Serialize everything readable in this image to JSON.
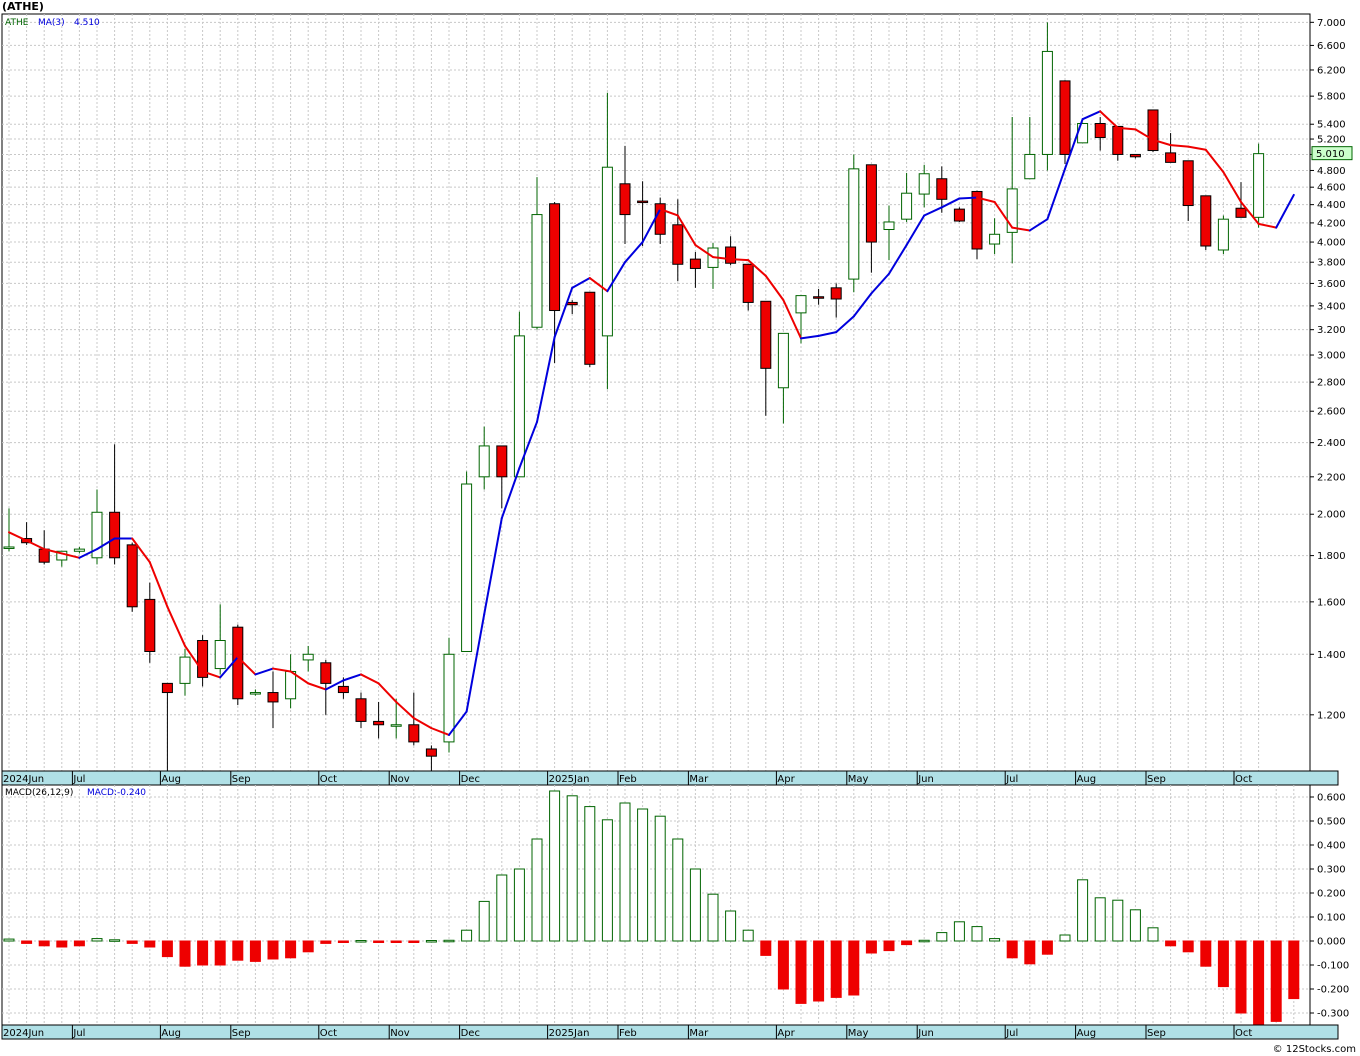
{
  "title": "(ATHE)",
  "watermark": "© 12Stocks.com",
  "colors": {
    "up": "#ffffff",
    "up_stroke": "#006400",
    "down": "#ee0000",
    "ma_up": "#0000dd",
    "ma_down": "#ee0000",
    "grid": "#c8c8c8",
    "axis_band": "#b0e0e6"
  },
  "chart_data": [
    {
      "type": "candlestick",
      "legend": {
        "ticker": "ATHE",
        "ma_label": "MA(3)",
        "ma_value": "4.510"
      },
      "last_price": "5.010",
      "y_scale": "log",
      "ylim": [
        1.04,
        7.15
      ],
      "y_ticks": [
        1.2,
        1.4,
        1.6,
        1.8,
        2.0,
        2.2,
        2.4,
        2.6,
        2.8,
        3.0,
        3.2,
        3.4,
        3.6,
        3.8,
        4.0,
        4.2,
        4.4,
        4.6,
        4.8,
        5.0,
        5.2,
        5.4,
        5.8,
        6.2,
        6.6,
        7.0
      ],
      "y_tick_labels": [
        "1.200",
        "1.400",
        "1.600",
        "1.800",
        "2.000",
        "2.200",
        "2.400",
        "2.600",
        "2.800",
        "3.000",
        "3.200",
        "3.400",
        "3.600",
        "3.800",
        "4.000",
        "4.200",
        "4.400",
        "4.600",
        "4.800",
        "5.000",
        "5.200",
        "5.400",
        "5.800",
        "6.200",
        "6.600",
        "7.000"
      ],
      "x_labels": [
        {
          "i": 0,
          "t": "2024Jun"
        },
        {
          "i": 4,
          "t": "Jul"
        },
        {
          "i": 9,
          "t": "Aug"
        },
        {
          "i": 13,
          "t": "Sep"
        },
        {
          "i": 18,
          "t": "Oct"
        },
        {
          "i": 22,
          "t": "Nov"
        },
        {
          "i": 26,
          "t": "Dec"
        },
        {
          "i": 31,
          "t": "2025Jan"
        },
        {
          "i": 35,
          "t": "Feb"
        },
        {
          "i": 39,
          "t": "Mar"
        },
        {
          "i": 44,
          "t": "Apr"
        },
        {
          "i": 48,
          "t": "May"
        },
        {
          "i": 52,
          "t": "Jun"
        },
        {
          "i": 57,
          "t": "Jul"
        },
        {
          "i": 61,
          "t": "Aug"
        },
        {
          "i": 65,
          "t": "Sep"
        },
        {
          "i": 70,
          "t": "Oct"
        }
      ],
      "candles": [
        [
          1.84,
          2.03,
          1.82,
          1.84
        ],
        [
          1.88,
          1.96,
          1.85,
          1.86
        ],
        [
          1.83,
          1.92,
          1.76,
          1.77
        ],
        [
          1.78,
          1.82,
          1.75,
          1.82
        ],
        [
          1.82,
          1.84,
          1.81,
          1.83
        ],
        [
          1.79,
          2.13,
          1.76,
          2.01
        ],
        [
          2.01,
          2.39,
          1.76,
          1.79
        ],
        [
          1.85,
          1.86,
          1.56,
          1.58
        ],
        [
          1.61,
          1.68,
          1.37,
          1.41
        ],
        [
          1.3,
          1.3,
          1.04,
          1.27
        ],
        [
          1.3,
          1.42,
          1.26,
          1.39
        ],
        [
          1.45,
          1.47,
          1.29,
          1.32
        ],
        [
          1.35,
          1.59,
          1.33,
          1.45
        ],
        [
          1.5,
          1.51,
          1.23,
          1.25
        ],
        [
          1.27,
          1.28,
          1.26,
          1.27
        ],
        [
          1.27,
          1.34,
          1.16,
          1.24
        ],
        [
          1.25,
          1.4,
          1.22,
          1.34
        ],
        [
          1.38,
          1.43,
          1.34,
          1.4
        ],
        [
          1.37,
          1.38,
          1.2,
          1.3
        ],
        [
          1.29,
          1.32,
          1.25,
          1.27
        ],
        [
          1.25,
          1.27,
          1.16,
          1.18
        ],
        [
          1.18,
          1.24,
          1.13,
          1.17
        ],
        [
          1.17,
          1.25,
          1.13,
          1.17
        ],
        [
          1.17,
          1.27,
          1.11,
          1.12
        ],
        [
          1.1,
          1.11,
          1.04,
          1.08
        ],
        [
          1.12,
          1.46,
          1.09,
          1.4
        ],
        [
          1.41,
          2.23,
          1.41,
          2.16
        ],
        [
          2.2,
          2.5,
          2.13,
          2.38
        ],
        [
          2.38,
          2.38,
          2.03,
          2.2
        ],
        [
          2.2,
          3.35,
          2.2,
          3.15
        ],
        [
          3.22,
          4.72,
          3.2,
          4.29
        ],
        [
          4.41,
          4.43,
          2.94,
          3.36
        ],
        [
          3.43,
          3.45,
          3.33,
          3.41
        ],
        [
          3.52,
          3.52,
          2.91,
          2.93
        ],
        [
          3.15,
          5.85,
          2.75,
          4.84
        ],
        [
          4.64,
          5.11,
          3.98,
          4.29
        ],
        [
          4.44,
          4.67,
          3.96,
          4.43
        ],
        [
          4.41,
          4.48,
          3.98,
          4.08
        ],
        [
          4.18,
          4.46,
          3.62,
          3.78
        ],
        [
          3.83,
          3.9,
          3.56,
          3.74
        ],
        [
          3.75,
          3.99,
          3.55,
          3.94
        ],
        [
          3.95,
          4.06,
          3.77,
          3.79
        ],
        [
          3.78,
          3.78,
          3.36,
          3.43
        ],
        [
          3.44,
          3.44,
          2.57,
          2.9
        ],
        [
          2.76,
          3.16,
          2.52,
          3.17
        ],
        [
          3.34,
          3.49,
          3.09,
          3.49
        ],
        [
          3.48,
          3.55,
          3.41,
          3.47
        ],
        [
          3.56,
          3.6,
          3.3,
          3.46
        ],
        [
          3.64,
          5.0,
          3.52,
          4.82
        ],
        [
          4.87,
          4.87,
          3.7,
          4.0
        ],
        [
          4.13,
          4.39,
          3.82,
          4.21
        ],
        [
          4.24,
          4.77,
          4.21,
          4.53
        ],
        [
          4.52,
          4.87,
          4.37,
          4.76
        ],
        [
          4.7,
          4.85,
          4.31,
          4.46
        ],
        [
          4.35,
          4.37,
          4.21,
          4.22
        ],
        [
          4.55,
          4.56,
          3.83,
          3.93
        ],
        [
          3.98,
          4.25,
          3.88,
          4.08
        ],
        [
          4.1,
          5.5,
          3.79,
          4.58
        ],
        [
          4.7,
          5.5,
          4.7,
          5.0
        ],
        [
          5.0,
          7.0,
          4.8,
          6.5
        ],
        [
          6.03,
          6.04,
          4.88,
          5.0
        ],
        [
          5.15,
          5.42,
          5.15,
          5.41
        ],
        [
          5.41,
          5.5,
          5.05,
          5.22
        ],
        [
          5.37,
          5.37,
          4.92,
          5.0
        ],
        [
          5.0,
          5.0,
          4.95,
          4.97
        ],
        [
          5.6,
          5.6,
          5.03,
          5.05
        ],
        [
          5.02,
          5.28,
          4.9,
          4.9
        ],
        [
          4.92,
          4.92,
          4.22,
          4.39
        ],
        [
          4.5,
          4.5,
          3.92,
          3.96
        ],
        [
          3.92,
          4.28,
          3.88,
          4.24
        ],
        [
          4.36,
          4.66,
          4.26,
          4.26
        ],
        [
          4.26,
          5.14,
          4.15,
          5.01
        ]
      ],
      "ma3": [
        1.91,
        1.87,
        1.83,
        1.81,
        1.79,
        1.83,
        1.88,
        1.88,
        1.77,
        1.58,
        1.43,
        1.34,
        1.32,
        1.39,
        1.33,
        1.35,
        1.34,
        1.3,
        1.28,
        1.31,
        1.33,
        1.3,
        1.24,
        1.19,
        1.16,
        1.14,
        1.21,
        1.55,
        1.98,
        2.25,
        2.53,
        3.14,
        3.56,
        3.65,
        3.53,
        3.8,
        4.0,
        4.35,
        4.28,
        3.97,
        3.85,
        3.83,
        3.82,
        3.67,
        3.45,
        3.13,
        3.15,
        3.18,
        3.31,
        3.51,
        3.69,
        3.97,
        4.28,
        4.37,
        4.47,
        4.48,
        4.43,
        4.15,
        4.12,
        4.24,
        4.82,
        5.47,
        5.58,
        5.35,
        5.33,
        5.19,
        5.12,
        5.1,
        5.06,
        4.78,
        4.43,
        4.19,
        4.15,
        4.51
      ]
    },
    {
      "type": "bar",
      "legend": {
        "label": "MACD(26,12,9)",
        "value_label": "MACD:-0.240"
      },
      "ylim": [
        -0.35,
        0.65
      ],
      "y_ticks": [
        -0.3,
        -0.2,
        -0.1,
        0.0,
        0.1,
        0.2,
        0.3,
        0.4,
        0.5,
        0.6
      ],
      "y_tick_labels": [
        "-0.300",
        "-0.200",
        "-0.100",
        "0.000",
        "0.100",
        "0.200",
        "0.300",
        "0.400",
        "0.500",
        "0.600"
      ],
      "values": [
        0.008,
        -0.01,
        -0.02,
        -0.025,
        -0.02,
        0.01,
        0.005,
        -0.01,
        -0.025,
        -0.065,
        -0.105,
        -0.1,
        -0.1,
        -0.08,
        -0.085,
        -0.075,
        -0.07,
        -0.045,
        -0.01,
        -0.005,
        0.002,
        -0.005,
        -0.005,
        -0.002,
        0.002,
        0.003,
        0.045,
        0.165,
        0.275,
        0.3,
        0.425,
        0.625,
        0.605,
        0.56,
        0.505,
        0.575,
        0.55,
        0.52,
        0.425,
        0.3,
        0.195,
        0.125,
        0.045,
        -0.06,
        -0.2,
        -0.26,
        -0.25,
        -0.235,
        -0.225,
        -0.05,
        -0.04,
        -0.015,
        0.003,
        0.035,
        0.08,
        0.06,
        0.01,
        -0.07,
        -0.095,
        -0.055,
        0.025,
        0.255,
        0.18,
        0.17,
        0.13,
        0.055,
        -0.02,
        -0.045,
        -0.105,
        -0.19,
        -0.3,
        -0.35,
        -0.335,
        -0.24
      ]
    }
  ]
}
